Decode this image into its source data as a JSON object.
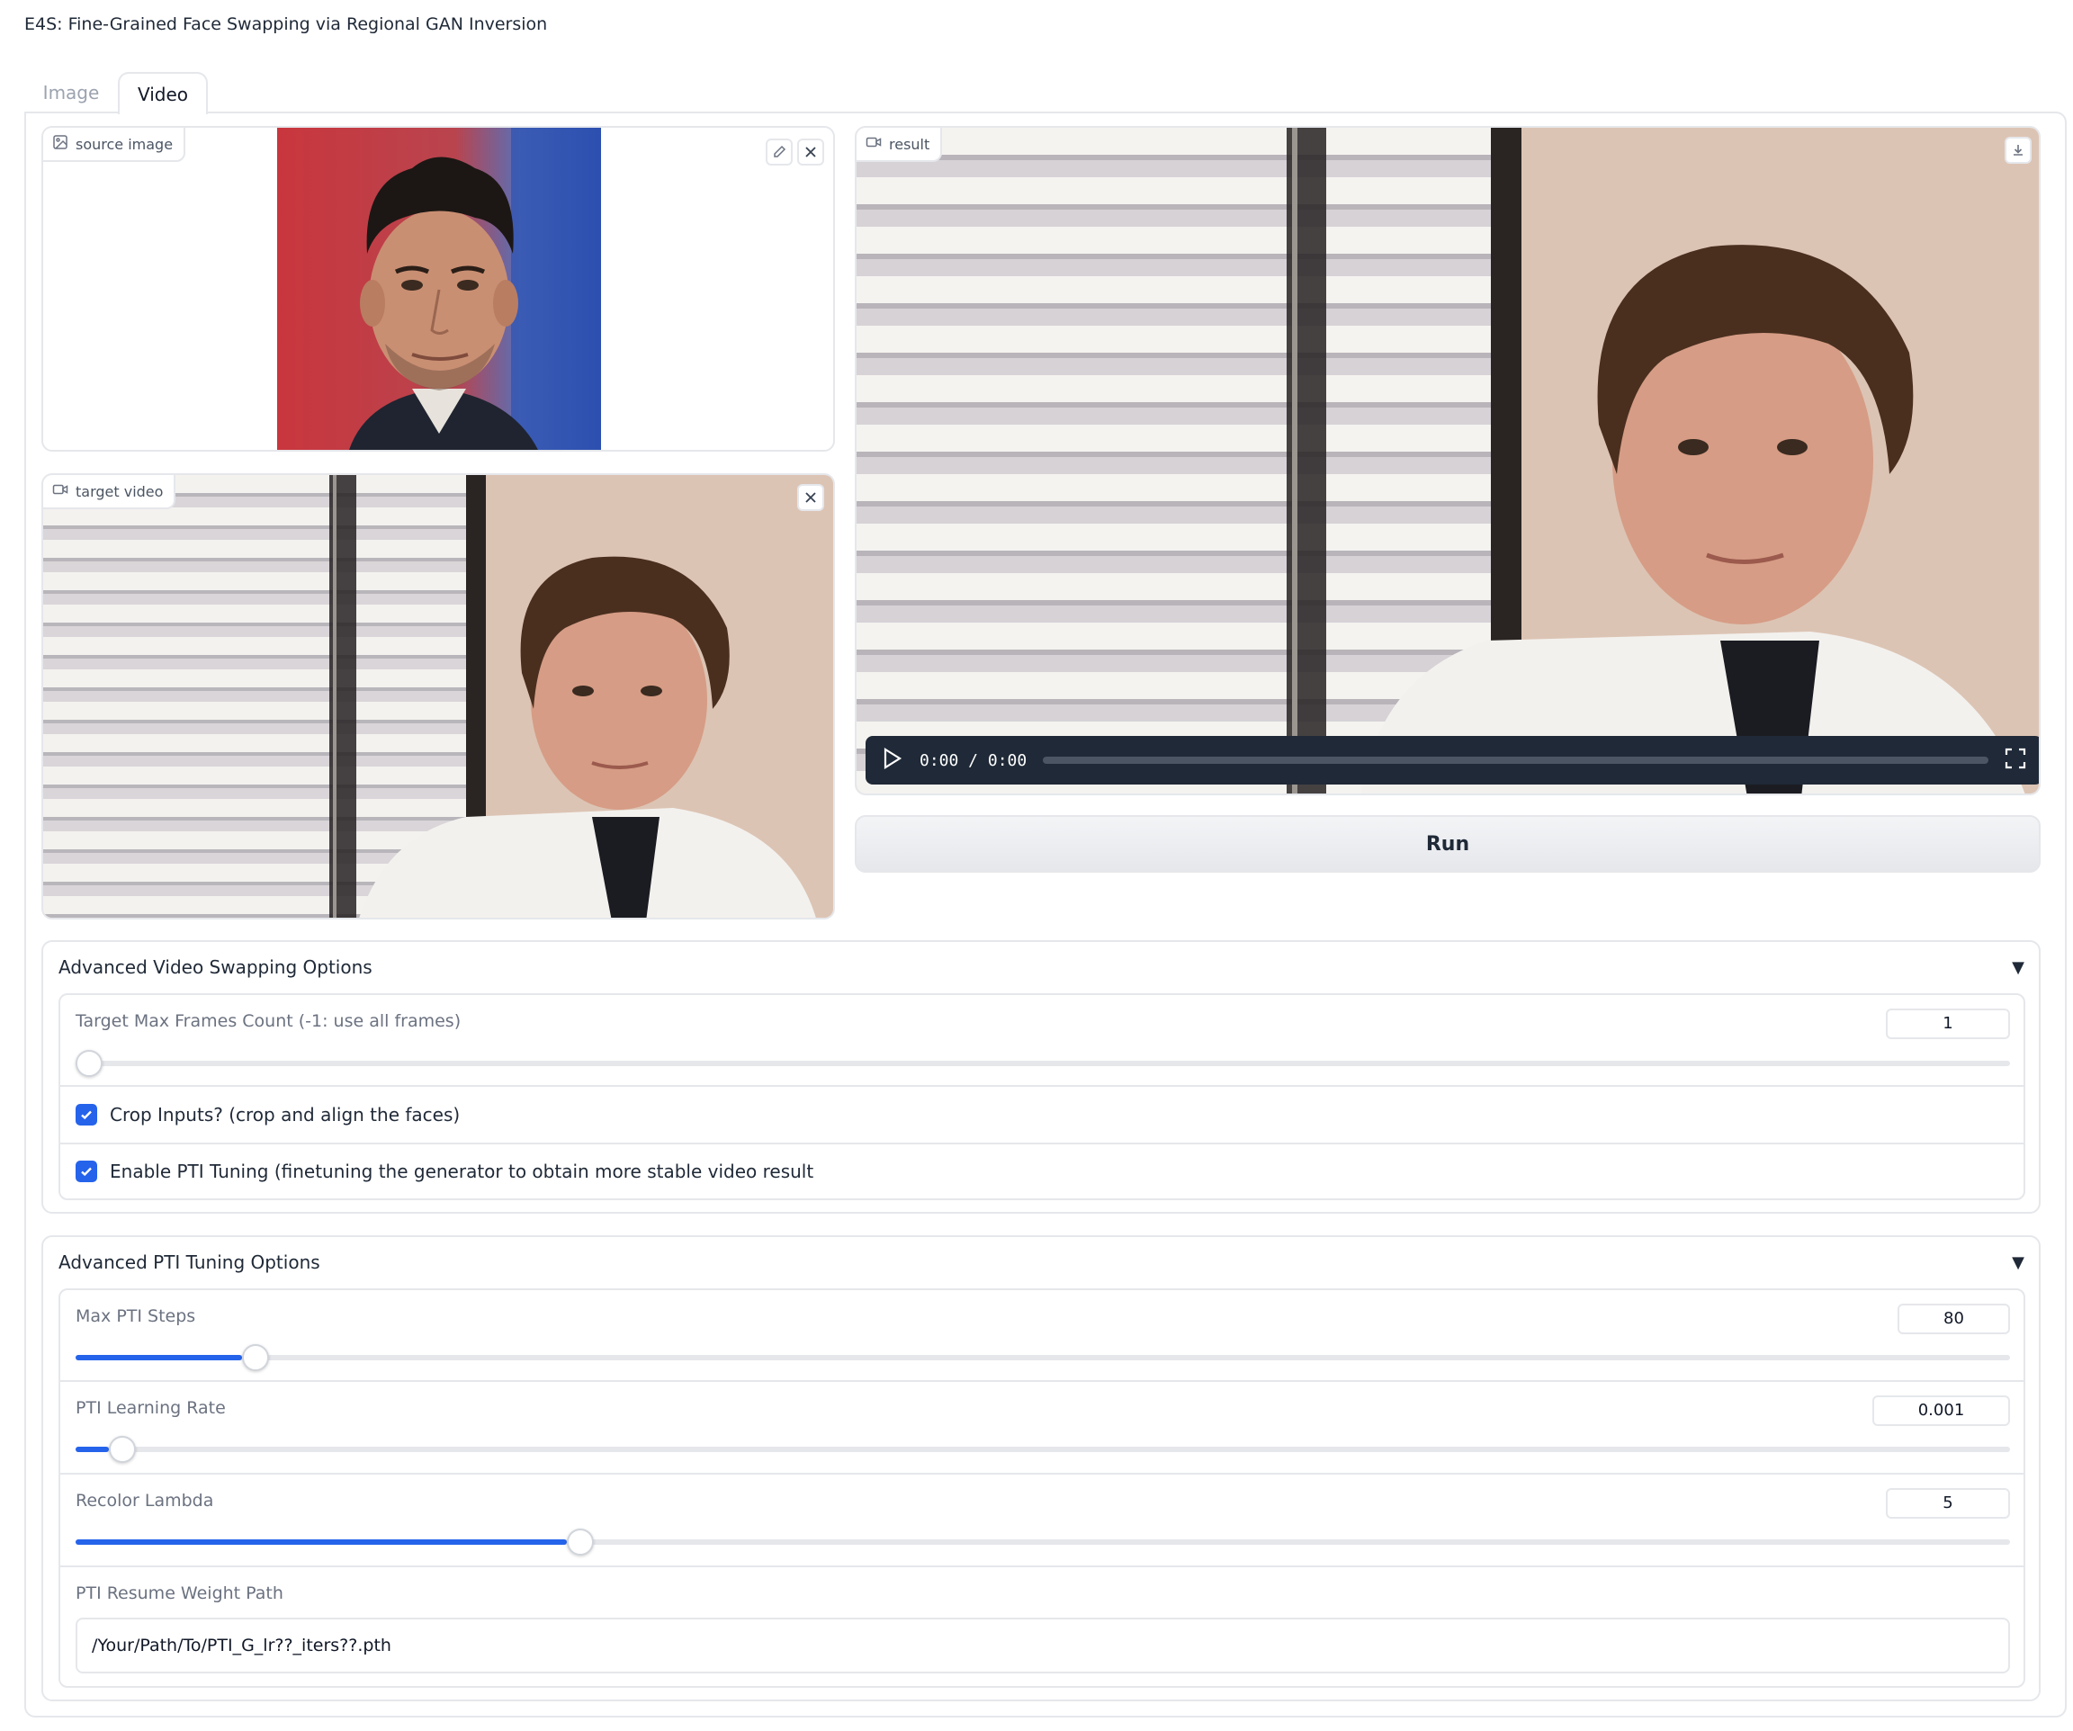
{
  "app": {
    "title": "E4S: Fine-Grained Face Swapping via Regional GAN Inversion"
  },
  "tabs": [
    {
      "label": "Image",
      "active": false
    },
    {
      "label": "Video",
      "active": true
    }
  ],
  "source_image": {
    "label": "source image",
    "icon": "image-icon"
  },
  "target_video": {
    "label": "target video",
    "icon": "video-camera-icon"
  },
  "result": {
    "label": "result",
    "icon": "video-camera-icon",
    "time_display": "0:00 / 0:00",
    "progress": 0
  },
  "run_button": {
    "label": "Run"
  },
  "video_options": {
    "title": "Advanced Video Swapping Options",
    "arrow": "▼",
    "max_frames": {
      "label": "Target Max Frames Count (-1: use all frames)",
      "value": "1",
      "fraction": 0
    },
    "crop_inputs": {
      "label": "Crop Inputs? (crop and align the faces)",
      "checked": true
    },
    "pti_tuning": {
      "label": "Enable PTI Tuning (finetuning the generator to obtain more stable video result",
      "checked": true
    }
  },
  "pti_options": {
    "title": "Advanced PTI Tuning Options",
    "arrow": "▼",
    "max_steps": {
      "label": "Max PTI Steps",
      "value": "80",
      "fraction": 0.086
    },
    "learning_rate": {
      "label": "PTI Learning Rate",
      "value": "0.001",
      "fraction": 0.017
    },
    "recolor_lambda": {
      "label": "Recolor Lambda",
      "value": "5",
      "fraction": 0.254
    },
    "resume_path": {
      "label": "PTI Resume Weight Path",
      "value": "/Your/Path/To/PTI_G_lr??_iters??.pth"
    }
  },
  "colors": {
    "accent": "#2563eb",
    "border": "#e5e7eb",
    "control_bar": "#1f2937"
  }
}
